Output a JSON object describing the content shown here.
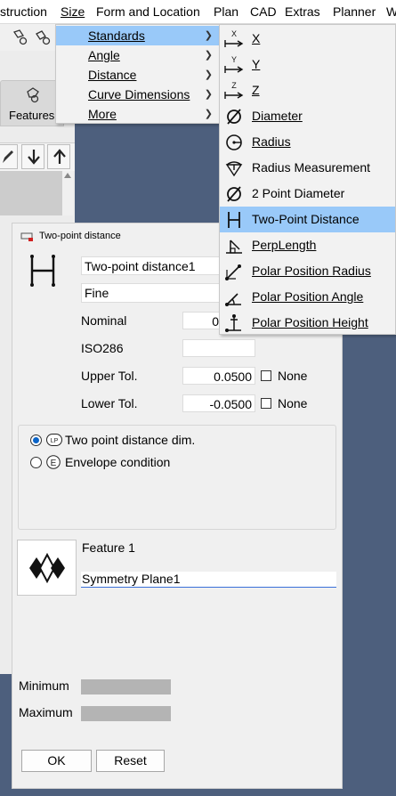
{
  "menubar": {
    "items": [
      "struction",
      "Size",
      "Form and Location",
      "Plan",
      "CAD",
      "Extras",
      "Planner",
      "W"
    ]
  },
  "background": {
    "features_tab_label": "Features"
  },
  "size_menu": {
    "items": [
      "Standards",
      "Angle",
      "Distance",
      "Curve Dimensions",
      "More"
    ]
  },
  "standards_submenu": {
    "items": [
      {
        "label": "X",
        "icon": "x-axis-icon"
      },
      {
        "label": "Y",
        "icon": "y-axis-icon"
      },
      {
        "label": "Z",
        "icon": "z-axis-icon"
      },
      {
        "label": "Diameter",
        "icon": "diameter-icon"
      },
      {
        "label": "Radius",
        "icon": "radius-icon"
      },
      {
        "label": "Radius Measurement",
        "icon": "radius-measurement-icon"
      },
      {
        "label": "2 Point Diameter",
        "icon": "two-point-diameter-icon"
      },
      {
        "label": "Two-Point Distance",
        "icon": "two-point-distance-icon"
      },
      {
        "label": "PerpLength",
        "icon": "perp-length-icon"
      },
      {
        "label": "Polar Position Radius",
        "icon": "polar-radius-icon"
      },
      {
        "label": "Polar Position Angle",
        "icon": "polar-angle-icon"
      },
      {
        "label": "Polar Position Height",
        "icon": "polar-height-icon"
      }
    ],
    "highlighted": "Two-Point Distance"
  },
  "dialog": {
    "title": "Two-point distance",
    "name_value": "Two-point distance1",
    "precision_value": "Fine",
    "nominal_label": "Nominal",
    "nominal_value": "0",
    "iso_label": "ISO286",
    "iso_value": "",
    "upper_tol_label": "Upper Tol.",
    "upper_tol_value": "0.0500",
    "lower_tol_label": "Lower Tol.",
    "lower_tol_value": "-0.0500",
    "none_label": "None",
    "radio_1_badge": "LP",
    "radio_1_label": "Two point distance dim.",
    "radio_2_badge": "E",
    "radio_2_label": "Envelope condition",
    "feature_label": "Feature 1",
    "feature_value": "Symmetry Plane1",
    "minimum_label": "Minimum",
    "maximum_label": "Maximum",
    "ok_label": "OK",
    "reset_label": "Reset"
  },
  "colors": {
    "highlight": "#99c9f9",
    "background": "#4d5f7d",
    "radio_selected": "#0a64c8"
  }
}
